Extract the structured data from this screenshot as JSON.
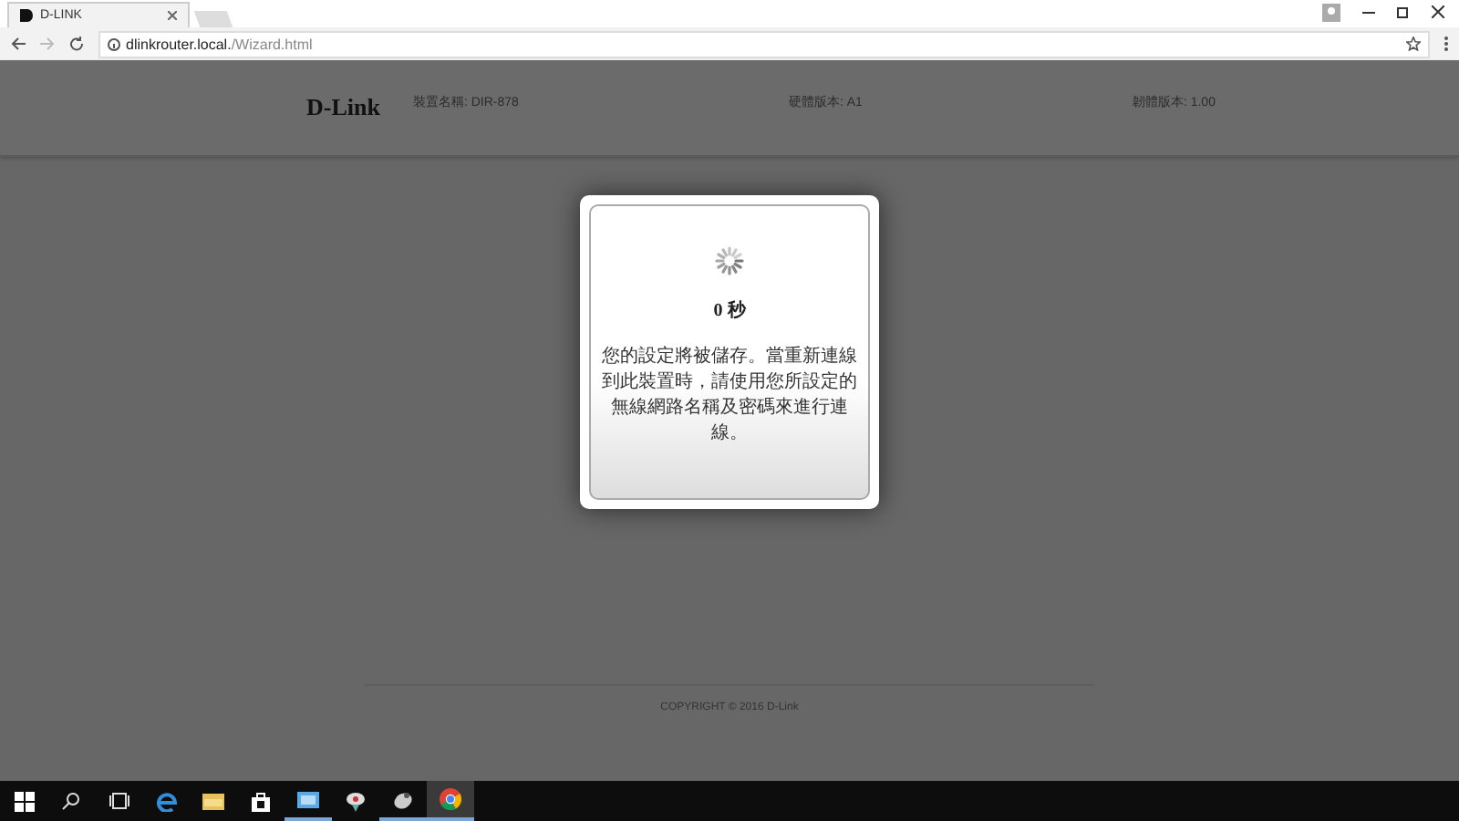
{
  "browser": {
    "tab_title": "D-LINK",
    "url_host": "dlinkrouter.local.",
    "url_path": "/Wizard.html"
  },
  "header": {
    "logo": "D-Link",
    "fields": [
      {
        "text": "裝置名稱: DIR-878"
      },
      {
        "text": "硬體版本: A1"
      },
      {
        "text": "韌體版本: 1.00"
      }
    ]
  },
  "dialog": {
    "countdown": "0 秒",
    "message": "您的設定將被儲存。當重新連線到此裝置時，請使用您所設定的無線網路名稱及密碼來進行連線。"
  },
  "footer": {
    "copyright": "COPYRIGHT © 2016 D-Link"
  }
}
